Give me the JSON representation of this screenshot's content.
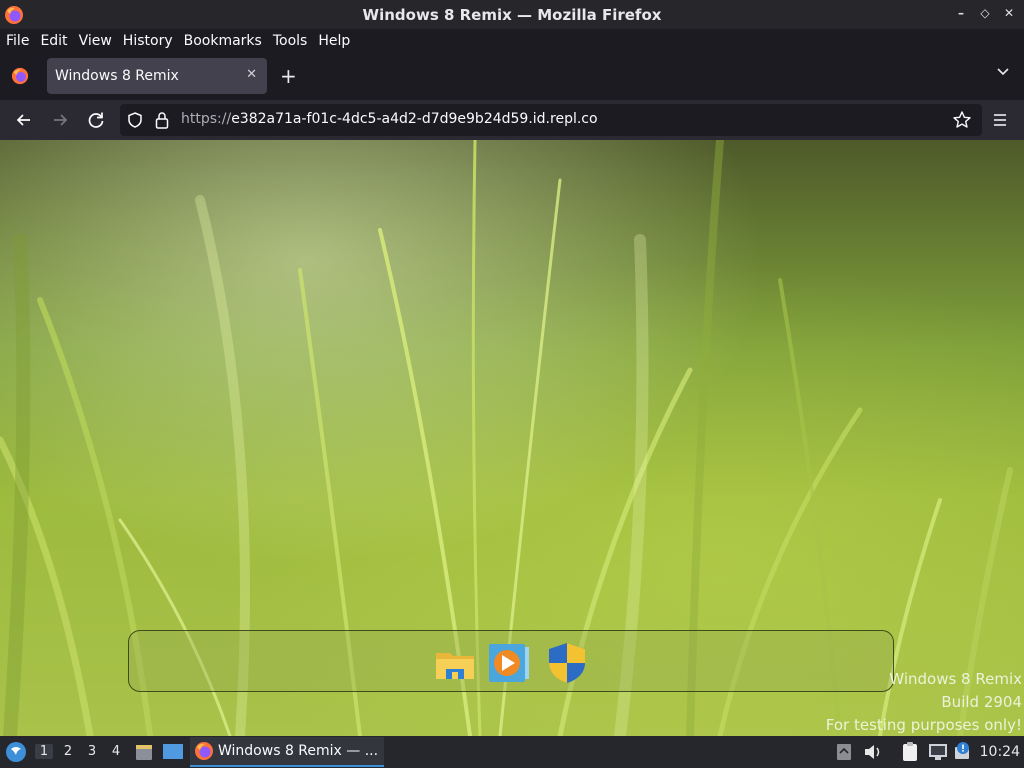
{
  "window": {
    "title": "Windows 8 Remix — Mozilla Firefox"
  },
  "menu": [
    "File",
    "Edit",
    "View",
    "History",
    "Bookmarks",
    "Tools",
    "Help"
  ],
  "tab": {
    "title": "Windows 8 Remix"
  },
  "url": {
    "scheme": "https://",
    "host": "e382a71a-f01c-4dc5-a4d2-d7d9e9b24d59.id.repl.co"
  },
  "page": {
    "dock_icons": [
      "file-explorer-icon",
      "media-player-icon",
      "security-shield-icon"
    ],
    "watermark": [
      "Windows 8 Remix",
      "Build 2904",
      "For testing purposes only!"
    ]
  },
  "taskbar": {
    "workspaces": [
      "1",
      "2",
      "3",
      "4"
    ],
    "active_workspace": "1",
    "window_label": "Windows 8 Remix — ...",
    "clock": "10:24"
  },
  "colors": {
    "accent": "#3d8fd8",
    "firefox_orange": "#ff7139",
    "firefox_purple": "#9059ff"
  }
}
